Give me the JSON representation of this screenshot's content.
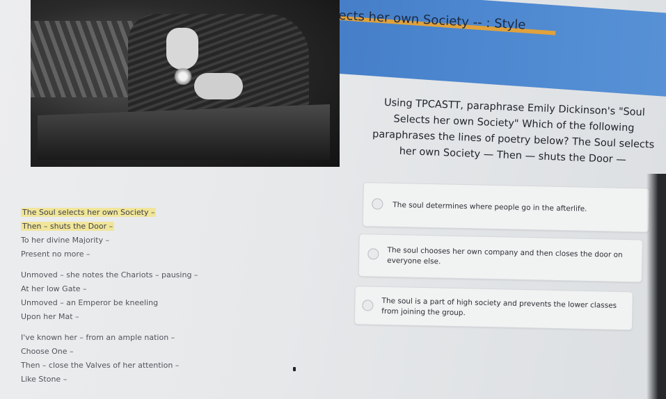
{
  "header": {
    "title": "The Soul selects her own Society -- : Style"
  },
  "question": {
    "text": "Using TPCASTT, paraphrase Emily Dickinson's \"Soul Selects her own Society\" Which of the following paraphrases the lines of poetry below? The Soul selects her own Society — Then — shuts the Door —"
  },
  "poem": {
    "stanza1": [
      "The Soul selects her own Society –",
      "Then – shuts the Door –",
      "To her divine Majority –",
      "Present no more –"
    ],
    "stanza2": [
      "Unmoved – she notes the Chariots – pausing –",
      "At her low Gate –",
      "Unmoved – an Emperor be kneeling",
      "Upon her Mat –"
    ],
    "stanza3": [
      "I've known her – from an ample nation –",
      "Choose One –",
      "Then – close the Valves of her attention –",
      "Like Stone –"
    ]
  },
  "answers": [
    {
      "text": "The soul determines where people go in the afterlife."
    },
    {
      "text": "The soul chooses her own company and then closes the door on everyone else."
    },
    {
      "text": "The soul is a part of high society and prevents the lower classes from joining the group."
    }
  ],
  "colors": {
    "header": "#3a6fb8",
    "highlight": "#f1e59a"
  },
  "icons": {
    "answer_radio": "radio-button-icon",
    "cursor": "mouse-pointer-icon"
  }
}
